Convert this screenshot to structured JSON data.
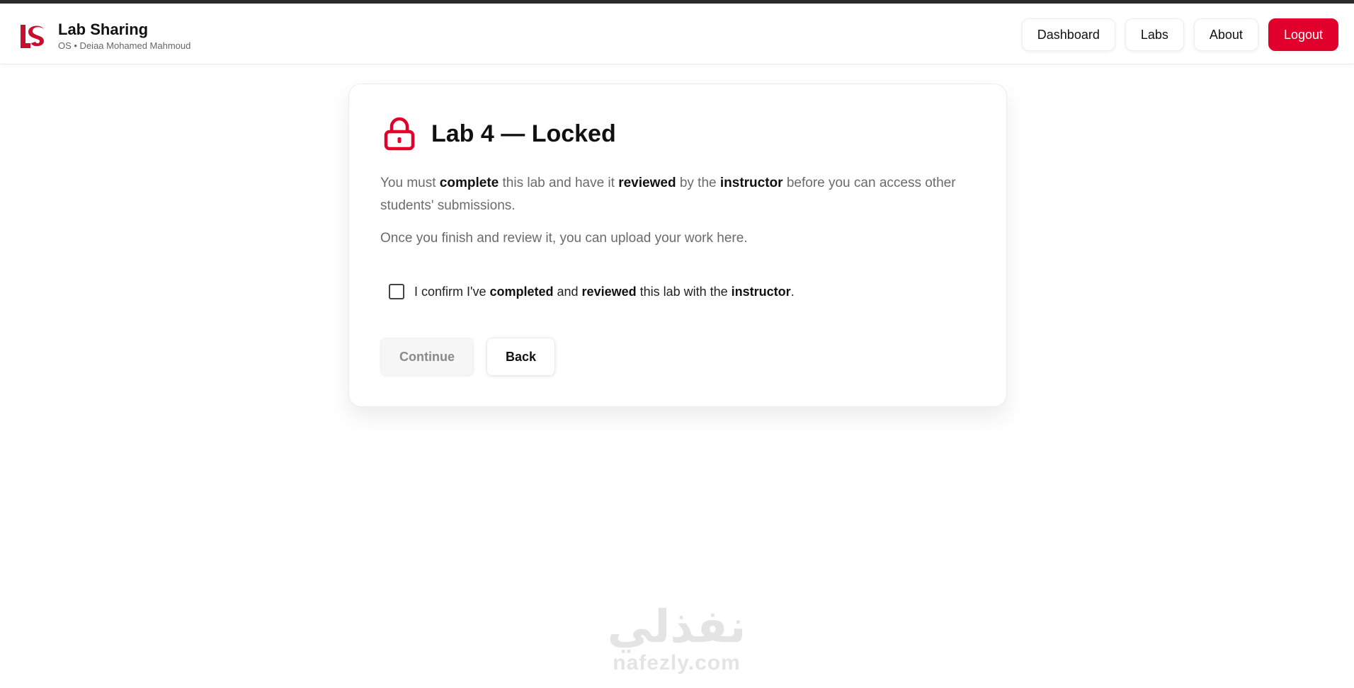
{
  "header": {
    "logo_text": "LS",
    "title": "Lab Sharing",
    "subtitle": "OS • Deiaa Mohamed Mahmoud",
    "nav": {
      "dashboard": "Dashboard",
      "labs": "Labs",
      "about": "About",
      "logout": "Logout"
    }
  },
  "card": {
    "icon": "lock-icon",
    "title": "Lab 4 — Locked",
    "p1": {
      "t1": "You must ",
      "b1": "complete",
      "t2": " this lab and have it ",
      "b2": "reviewed",
      "t3": " by the ",
      "b3": "instructor",
      "t4": " before you can access other students' submissions."
    },
    "p2": "Once you finish and review it, you can upload your work here.",
    "confirm": {
      "checked": false,
      "t1": "I confirm I've ",
      "b1": "completed",
      "t2": " and ",
      "b2": "reviewed",
      "t3": " this lab with the ",
      "b3": "instructor",
      "t4": "."
    },
    "buttons": {
      "continue": "Continue",
      "back": "Back"
    }
  },
  "watermark": {
    "arabic": "نفذلي",
    "latin": "nafezly.com"
  },
  "colors": {
    "accent": "#e0002b",
    "logo": "#c8102e",
    "muted_text": "#6b6b6b"
  }
}
